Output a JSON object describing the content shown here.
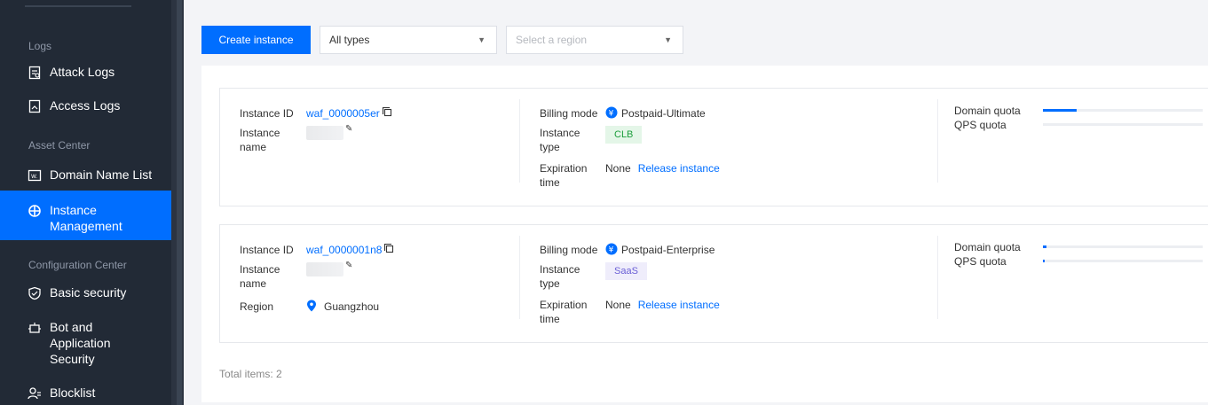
{
  "sidebar": {
    "sections": {
      "logs": "Logs",
      "asset_center": "Asset Center",
      "config_center": "Configuration Center"
    },
    "items": [
      {
        "label": "Attack Logs",
        "icon": "attack-log-icon"
      },
      {
        "label": "Access Logs",
        "icon": "access-log-icon"
      },
      {
        "label": "Domain Name List",
        "icon": "domain-list-icon"
      },
      {
        "label": "Instance Management",
        "icon": "instance-icon",
        "active": true
      },
      {
        "label": "Basic security",
        "icon": "shield-icon"
      },
      {
        "label": "Bot and Application Security",
        "icon": "bot-icon"
      },
      {
        "label": "Blocklist",
        "icon": "blocklist-icon"
      }
    ]
  },
  "toolbar": {
    "create_label": "Create instance",
    "type_select": "All types",
    "region_placeholder": "Select a region"
  },
  "labels": {
    "instance_id": "Instance ID",
    "instance": "Instance",
    "name": "name",
    "region": "Region",
    "billing_mode": "Billing mode",
    "instance_type_1": "Instance",
    "instance_type_2": "type",
    "expiration_1": "Expiration",
    "expiration_2": "time",
    "domain_quota": "Domain quota",
    "qps_quota": "QPS quota",
    "release": "Release instance"
  },
  "instances": [
    {
      "id": "waf_0000005er",
      "billing": "Postpaid-Ultimate",
      "type": "CLB",
      "expiration": "None",
      "domain_quota_pct": 0.21,
      "qps_quota_pct": 0.0
    },
    {
      "id": "waf_0000001n8",
      "billing": "Postpaid-Enterprise",
      "type": "SaaS",
      "region": "Guangzhou",
      "expiration": "None",
      "domain_quota_pct": 0.02,
      "qps_quota_pct": 0.01
    }
  ],
  "total_text": "Total items: 2",
  "colors": {
    "accent": "#006eff",
    "sidebar_bg": "#222a36",
    "clb_tag": "#1c9e3c",
    "saas_tag": "#6a5fd6"
  }
}
